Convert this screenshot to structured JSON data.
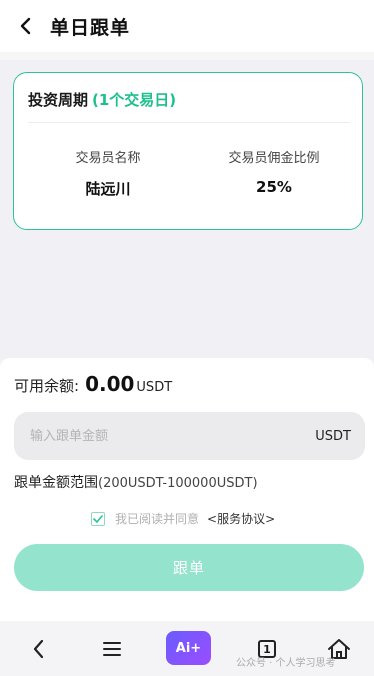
{
  "header": {
    "title": "单日跟单"
  },
  "card": {
    "title": "投资周期",
    "period": "(1个交易日)",
    "trader_name_label": "交易员名称",
    "trader_name": "陆远川",
    "commission_label": "交易员佣金比例",
    "commission": "25%"
  },
  "form": {
    "balance_label": "可用余额:",
    "balance_value": "0.00",
    "balance_unit": "USDT",
    "amount_placeholder": "输入跟单金额",
    "amount_value": "",
    "amount_unit": "USDT",
    "range_label": "跟单金额范围",
    "range_value": "(200USDT-100000USDT)",
    "agree_checked": true,
    "agree_text": "我已阅读并同意",
    "agreement_link": "<服务协议>",
    "submit_label": "跟单"
  },
  "bottom_nav": {
    "ai_label": "Ai+",
    "tab_count": "1",
    "watermark": "公众号 · 个人学习思考"
  },
  "colors": {
    "accent": "#1dbf8d",
    "button": "#93e3cd",
    "card_border": "#2cc39a"
  }
}
